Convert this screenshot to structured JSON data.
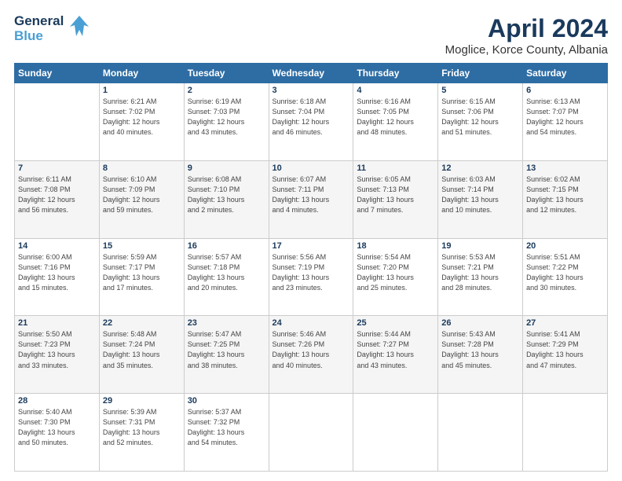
{
  "header": {
    "logo_line1": "General",
    "logo_line2": "Blue",
    "title": "April 2024",
    "subtitle": "Moglice, Korce County, Albania"
  },
  "weekdays": [
    "Sunday",
    "Monday",
    "Tuesday",
    "Wednesday",
    "Thursday",
    "Friday",
    "Saturday"
  ],
  "weeks": [
    [
      {
        "day": "",
        "info": ""
      },
      {
        "day": "1",
        "info": "Sunrise: 6:21 AM\nSunset: 7:02 PM\nDaylight: 12 hours\nand 40 minutes."
      },
      {
        "day": "2",
        "info": "Sunrise: 6:19 AM\nSunset: 7:03 PM\nDaylight: 12 hours\nand 43 minutes."
      },
      {
        "day": "3",
        "info": "Sunrise: 6:18 AM\nSunset: 7:04 PM\nDaylight: 12 hours\nand 46 minutes."
      },
      {
        "day": "4",
        "info": "Sunrise: 6:16 AM\nSunset: 7:05 PM\nDaylight: 12 hours\nand 48 minutes."
      },
      {
        "day": "5",
        "info": "Sunrise: 6:15 AM\nSunset: 7:06 PM\nDaylight: 12 hours\nand 51 minutes."
      },
      {
        "day": "6",
        "info": "Sunrise: 6:13 AM\nSunset: 7:07 PM\nDaylight: 12 hours\nand 54 minutes."
      }
    ],
    [
      {
        "day": "7",
        "info": "Sunrise: 6:11 AM\nSunset: 7:08 PM\nDaylight: 12 hours\nand 56 minutes."
      },
      {
        "day": "8",
        "info": "Sunrise: 6:10 AM\nSunset: 7:09 PM\nDaylight: 12 hours\nand 59 minutes."
      },
      {
        "day": "9",
        "info": "Sunrise: 6:08 AM\nSunset: 7:10 PM\nDaylight: 13 hours\nand 2 minutes."
      },
      {
        "day": "10",
        "info": "Sunrise: 6:07 AM\nSunset: 7:11 PM\nDaylight: 13 hours\nand 4 minutes."
      },
      {
        "day": "11",
        "info": "Sunrise: 6:05 AM\nSunset: 7:13 PM\nDaylight: 13 hours\nand 7 minutes."
      },
      {
        "day": "12",
        "info": "Sunrise: 6:03 AM\nSunset: 7:14 PM\nDaylight: 13 hours\nand 10 minutes."
      },
      {
        "day": "13",
        "info": "Sunrise: 6:02 AM\nSunset: 7:15 PM\nDaylight: 13 hours\nand 12 minutes."
      }
    ],
    [
      {
        "day": "14",
        "info": "Sunrise: 6:00 AM\nSunset: 7:16 PM\nDaylight: 13 hours\nand 15 minutes."
      },
      {
        "day": "15",
        "info": "Sunrise: 5:59 AM\nSunset: 7:17 PM\nDaylight: 13 hours\nand 17 minutes."
      },
      {
        "day": "16",
        "info": "Sunrise: 5:57 AM\nSunset: 7:18 PM\nDaylight: 13 hours\nand 20 minutes."
      },
      {
        "day": "17",
        "info": "Sunrise: 5:56 AM\nSunset: 7:19 PM\nDaylight: 13 hours\nand 23 minutes."
      },
      {
        "day": "18",
        "info": "Sunrise: 5:54 AM\nSunset: 7:20 PM\nDaylight: 13 hours\nand 25 minutes."
      },
      {
        "day": "19",
        "info": "Sunrise: 5:53 AM\nSunset: 7:21 PM\nDaylight: 13 hours\nand 28 minutes."
      },
      {
        "day": "20",
        "info": "Sunrise: 5:51 AM\nSunset: 7:22 PM\nDaylight: 13 hours\nand 30 minutes."
      }
    ],
    [
      {
        "day": "21",
        "info": "Sunrise: 5:50 AM\nSunset: 7:23 PM\nDaylight: 13 hours\nand 33 minutes."
      },
      {
        "day": "22",
        "info": "Sunrise: 5:48 AM\nSunset: 7:24 PM\nDaylight: 13 hours\nand 35 minutes."
      },
      {
        "day": "23",
        "info": "Sunrise: 5:47 AM\nSunset: 7:25 PM\nDaylight: 13 hours\nand 38 minutes."
      },
      {
        "day": "24",
        "info": "Sunrise: 5:46 AM\nSunset: 7:26 PM\nDaylight: 13 hours\nand 40 minutes."
      },
      {
        "day": "25",
        "info": "Sunrise: 5:44 AM\nSunset: 7:27 PM\nDaylight: 13 hours\nand 43 minutes."
      },
      {
        "day": "26",
        "info": "Sunrise: 5:43 AM\nSunset: 7:28 PM\nDaylight: 13 hours\nand 45 minutes."
      },
      {
        "day": "27",
        "info": "Sunrise: 5:41 AM\nSunset: 7:29 PM\nDaylight: 13 hours\nand 47 minutes."
      }
    ],
    [
      {
        "day": "28",
        "info": "Sunrise: 5:40 AM\nSunset: 7:30 PM\nDaylight: 13 hours\nand 50 minutes."
      },
      {
        "day": "29",
        "info": "Sunrise: 5:39 AM\nSunset: 7:31 PM\nDaylight: 13 hours\nand 52 minutes."
      },
      {
        "day": "30",
        "info": "Sunrise: 5:37 AM\nSunset: 7:32 PM\nDaylight: 13 hours\nand 54 minutes."
      },
      {
        "day": "",
        "info": ""
      },
      {
        "day": "",
        "info": ""
      },
      {
        "day": "",
        "info": ""
      },
      {
        "day": "",
        "info": ""
      }
    ]
  ]
}
